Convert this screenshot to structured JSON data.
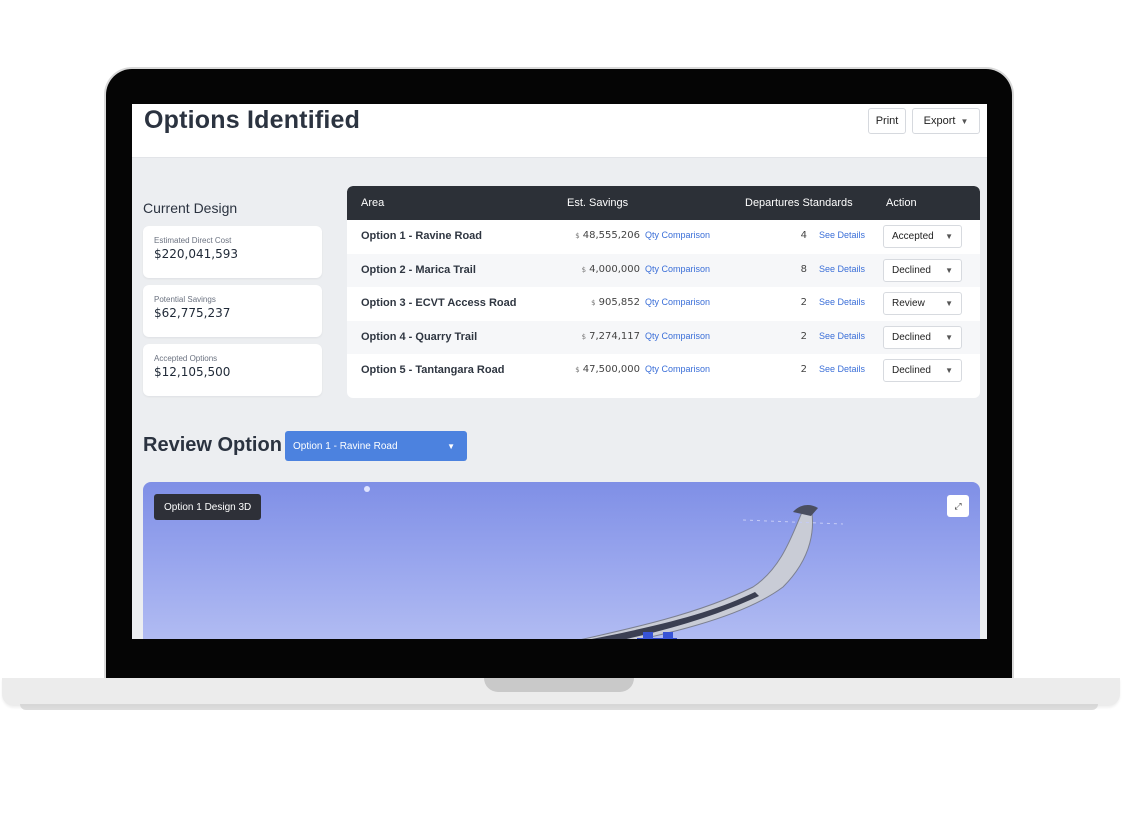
{
  "header": {
    "title": "Options Identified",
    "print_label": "Print",
    "export_label": "Export"
  },
  "current_design": {
    "title": "Current Design",
    "cards": [
      {
        "label": "Estimated Direct Cost",
        "value": "$220,041,593"
      },
      {
        "label": "Potential Savings",
        "value": "$62,775,237"
      },
      {
        "label": "Accepted Options",
        "value": "$12,105,500"
      }
    ]
  },
  "table": {
    "headers": {
      "area": "Area",
      "savings": "Est. Savings",
      "departures": "Departures Standards",
      "action": "Action"
    },
    "rows": [
      {
        "area": "Option 1 - Ravine Road",
        "currency": "$",
        "savings": "48,555,206",
        "qty_link": "Qty Comparison",
        "departures": "4",
        "details_link": "See Details",
        "action": "Accepted"
      },
      {
        "area": "Option 2 - Marica Trail",
        "currency": "$",
        "savings": "4,000,000",
        "qty_link": "Qty Comparison",
        "departures": "8",
        "details_link": "See Details",
        "action": "Declined"
      },
      {
        "area": "Option 3 - ECVT Access Road",
        "currency": "$",
        "savings": "905,852",
        "qty_link": "Qty Comparison",
        "departures": "2",
        "details_link": "See Details",
        "action": "Review"
      },
      {
        "area": "Option 4 - Quarry Trail",
        "currency": "$",
        "savings": "7,274,117",
        "qty_link": "Qty Comparison",
        "departures": "2",
        "details_link": "See Details",
        "action": "Declined"
      },
      {
        "area": "Option 5 - Tantangara Road",
        "currency": "$",
        "savings": "47,500,000",
        "qty_link": "Qty Comparison",
        "departures": "2",
        "details_link": "See Details",
        "action": "Declined"
      }
    ]
  },
  "review": {
    "title": "Review Option",
    "selected_option": "Option 1 - Ravine Road",
    "viewer_label": "Option 1 Design 3D"
  },
  "icons": {
    "caret": "caret-down-icon",
    "expand": "expand-icon"
  },
  "colors": {
    "header_dark": "#2c3037",
    "link_blue": "#3b6fd8",
    "select_blue": "#4c82df",
    "viewer_sky": "#8e9cea"
  }
}
